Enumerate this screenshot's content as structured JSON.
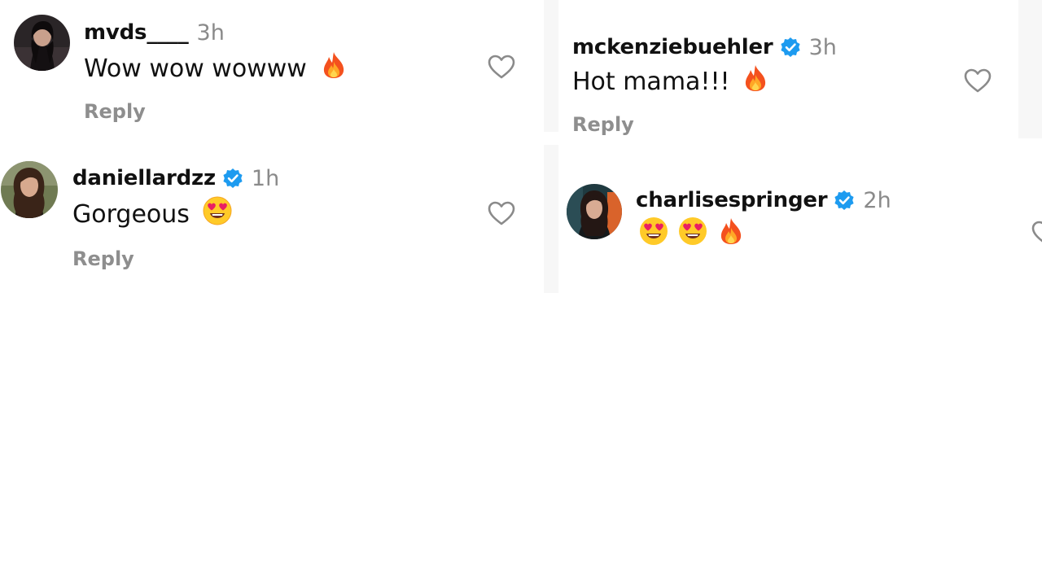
{
  "comments": [
    {
      "username": "mvds____",
      "verified": false,
      "time": "3h",
      "text": "Wow wow wowww",
      "emojis": [
        "fire"
      ],
      "reply_label": "Reply"
    },
    {
      "username": "daniellardzz",
      "verified": true,
      "time": "1h",
      "text": "Gorgeous",
      "emojis": [
        "heart-eyes"
      ],
      "reply_label": "Reply"
    },
    {
      "username": "mckenziebuehler",
      "verified": true,
      "time": "3h",
      "text": "Hot mama!!!",
      "emojis": [
        "fire"
      ],
      "reply_label": "Reply"
    },
    {
      "username": "charlisespringer",
      "verified": true,
      "time": "2h",
      "text": "",
      "emojis": [
        "heart-eyes",
        "heart-eyes",
        "fire"
      ]
    }
  ],
  "colors": {
    "text": "#111111",
    "muted": "#8e8e8e",
    "verified": "#1d9bf0",
    "heart_outline": "#8a8a8a"
  }
}
